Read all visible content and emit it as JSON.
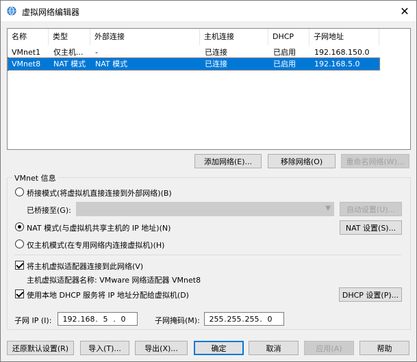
{
  "window": {
    "title": "虚拟网络编辑器",
    "close_glyph": "✕"
  },
  "list": {
    "headers": [
      "名称",
      "类型",
      "外部连接",
      "主机连接",
      "DHCP",
      "子网地址"
    ],
    "rows": [
      {
        "name": "VMnet1",
        "type": "仅主机...",
        "external": "-",
        "host": "已连接",
        "dhcp": "已启用",
        "subnet": "192.168.150.0",
        "selected": false
      },
      {
        "name": "VMnet8",
        "type": "NAT 模式",
        "external": "NAT 模式",
        "host": "已连接",
        "dhcp": "已启用",
        "subnet": "192.168.5.0",
        "selected": true
      }
    ]
  },
  "list_buttons": {
    "add": "添加网络(E)...",
    "remove": "移除网络(O)",
    "rename": "重命名网络(W)..."
  },
  "vmnet_info": {
    "group_label": "VMnet 信息",
    "bridge_label": "桥接模式(将虚拟机直接连接到外部网络)(B)",
    "bridged_to_label": "已桥接至(G):",
    "bridged_to_value": "",
    "auto_settings": "自动设置(U)...",
    "nat_label": "NAT 模式(与虚拟机共享主机的 IP 地址)(N)",
    "nat_settings": "NAT 设置(S)...",
    "hostonly_label": "仅主机模式(在专用网络内连接虚拟机)(H)",
    "selected_mode": "nat",
    "connect_adapter_label": "将主机虚拟适配器连接到此网络(V)",
    "connect_adapter_checked": true,
    "adapter_name_label": "主机虚拟适配器名称: VMware 网络适配器 VMnet8",
    "use_dhcp_label": "使用本地 DHCP 服务将 IP 地址分配给虚拟机(D)",
    "use_dhcp_checked": true,
    "dhcp_settings": "DHCP 设置(P)...",
    "subnet_ip_label": "子网 IP (I):",
    "subnet_ip": [
      "192",
      "168",
      "5",
      "0"
    ],
    "subnet_mask_label": "子网掩码(M):",
    "subnet_mask": [
      "255",
      "255",
      "255",
      "0"
    ]
  },
  "footer": {
    "restore": "还原默认设置(R)",
    "import": "导入(T)...",
    "export": "导出(X)...",
    "ok": "确定",
    "cancel": "取消",
    "apply": "应用(A)",
    "help": "帮助"
  },
  "colors": {
    "selection": "#0078d7",
    "default_button_border": "#0078d7"
  }
}
